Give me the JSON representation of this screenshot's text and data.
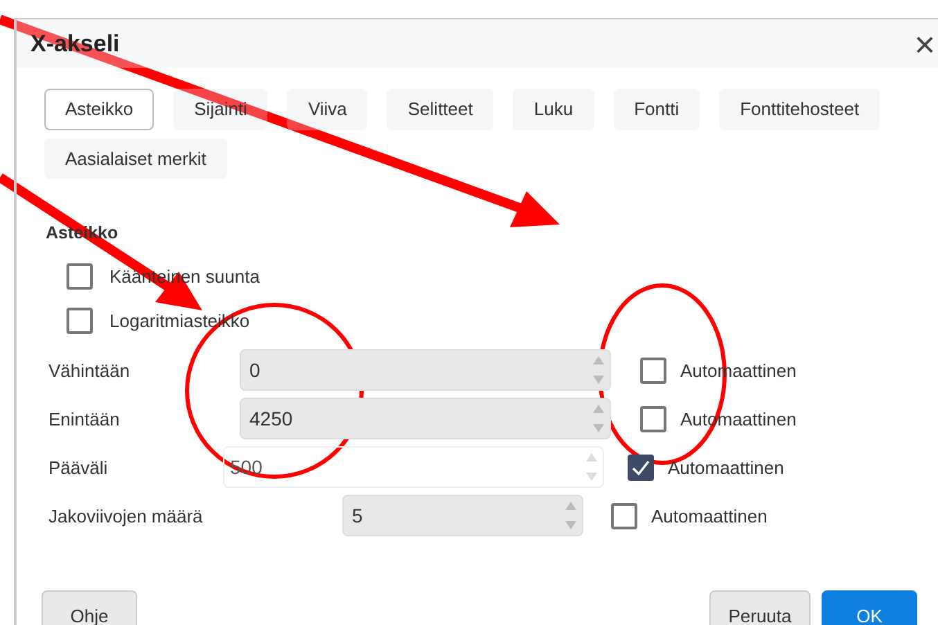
{
  "window": {
    "title": "X-akseli",
    "close": "×"
  },
  "tabs": [
    {
      "label": "Asteikko",
      "selected": true
    },
    {
      "label": "Sijainti",
      "selected": false
    },
    {
      "label": "Viiva",
      "selected": false
    },
    {
      "label": "Selitteet",
      "selected": false
    },
    {
      "label": "Luku",
      "selected": false
    },
    {
      "label": "Fontti",
      "selected": false
    },
    {
      "label": "Fonttitehosteet",
      "selected": false
    },
    {
      "label": "Aasialaiset merkit",
      "selected": false
    }
  ],
  "section": {
    "title": "Asteikko"
  },
  "options": [
    {
      "label": "Käänteinen suunta",
      "checked": false
    },
    {
      "label": "Logaritmiasteikko",
      "checked": false
    }
  ],
  "fields": [
    {
      "label": "Vähintään",
      "value": "0",
      "disabled": true,
      "auto": {
        "label": "Automaattinen",
        "checked": false
      }
    },
    {
      "label": "Enintään",
      "value": "4250",
      "disabled": true,
      "auto": {
        "label": "Automaattinen",
        "checked": false
      }
    },
    {
      "label": "Pääväli",
      "value": "500",
      "disabled": false,
      "auto": {
        "label": "Automaattinen",
        "checked": true
      }
    },
    {
      "label": "Jakoviivojen määrä",
      "value": "5",
      "disabled": true,
      "auto": {
        "label": "Automaattinen",
        "checked": false
      }
    }
  ],
  "buttons": [
    {
      "label": "Ohje",
      "kind": "help"
    },
    {
      "label": "Peruuta",
      "kind": "cancel"
    },
    {
      "label": "OK",
      "kind": "ok"
    }
  ]
}
